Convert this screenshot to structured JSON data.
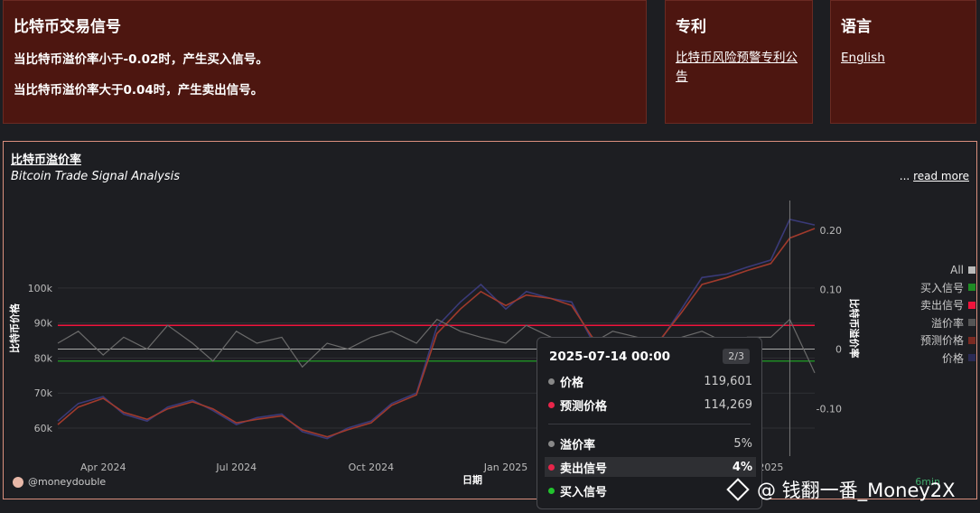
{
  "header": {
    "signals_title": "比特币交易信号",
    "buy_rule": "当比特币溢价率小于-0.02时，产生买入信号。",
    "sell_rule": "当比特币溢价率大于0.04时，产生卖出信号。",
    "patent_title": "专利",
    "patent_link": "比特币风险预警专利公告",
    "language_title": "语言",
    "language_link": "English"
  },
  "chart_panel": {
    "title": "比特币溢价率",
    "subtitle": "Bitcoin Trade Signal Analysis",
    "read_more_prefix": "...",
    "read_more": "read more",
    "author": "@moneydouble",
    "timeframe": "6min"
  },
  "tooltip": {
    "datetime": "2025-07-14 00:00",
    "page": "2/3",
    "rows": [
      {
        "label": "价格",
        "value": "119,601",
        "color": "#888888"
      },
      {
        "label": "预测价格",
        "value": "114,269",
        "color": "#e8254a"
      },
      {
        "label": "溢价率",
        "value": "5%",
        "color": "#888888"
      },
      {
        "label": "卖出信号",
        "value": "4%",
        "color": "#e8254a"
      },
      {
        "label": "买入信号",
        "value": "",
        "color": "#22c32e"
      }
    ]
  },
  "watermark": "@ 钱翻一番_Money2X",
  "chart_data": {
    "type": "line",
    "xlabel": "日期",
    "ylabel_left": "比特币价格",
    "ylabel_right": "比特币溢价率",
    "x_ticks": [
      "Apr 2024",
      "Jul 2024",
      "Oct 2024",
      "Jan 2025",
      "2025"
    ],
    "y_left_ticks": [
      "60k",
      "70k",
      "80k",
      "90k",
      "100k"
    ],
    "y_left_tick_values": [
      60000,
      70000,
      80000,
      90000,
      100000
    ],
    "y_right_ticks": [
      "-0.10",
      "0",
      "0.10",
      "0.20"
    ],
    "y_right_tick_values": [
      -0.1,
      0,
      0.1,
      0.2
    ],
    "ylim_left": [
      52000,
      125000
    ],
    "ylim_right": [
      -0.18,
      0.25
    ],
    "sell_threshold": 0.04,
    "buy_threshold": -0.02,
    "legend": [
      {
        "name": "All",
        "color": "#bbbbbb"
      },
      {
        "name": "买入信号",
        "color": "#1f8b24"
      },
      {
        "name": "卖出信号",
        "color": "#f0143c"
      },
      {
        "name": "溢价率",
        "color": "#555555"
      },
      {
        "name": "预测价格",
        "color": "#7a2a22"
      },
      {
        "name": "价格",
        "color": "#2b2b55"
      }
    ],
    "x_range": [
      "2024-03-01",
      "2025-07-31"
    ],
    "series": [
      {
        "name": "价格",
        "dates": [
          "2024-03-01",
          "2024-03-15",
          "2024-04-01",
          "2024-04-15",
          "2024-05-01",
          "2024-05-15",
          "2024-06-01",
          "2024-06-15",
          "2024-07-01",
          "2024-07-15",
          "2024-08-01",
          "2024-08-15",
          "2024-09-01",
          "2024-09-15",
          "2024-10-01",
          "2024-10-15",
          "2024-11-01",
          "2024-11-15",
          "2024-12-01",
          "2024-12-15",
          "2025-01-01",
          "2025-01-15",
          "2025-02-01",
          "2025-02-15",
          "2025-03-01",
          "2025-03-15",
          "2025-04-01",
          "2025-04-15",
          "2025-05-01",
          "2025-05-15",
          "2025-06-01",
          "2025-06-15",
          "2025-07-01",
          "2025-07-14",
          "2025-07-31"
        ],
        "values": [
          62000,
          67000,
          69000,
          64000,
          62000,
          66000,
          68000,
          65000,
          61000,
          63000,
          64000,
          59000,
          57000,
          60000,
          62000,
          67000,
          70000,
          89000,
          96000,
          101000,
          94000,
          99000,
          97000,
          96000,
          85000,
          83000,
          82000,
          84000,
          94000,
          103000,
          104000,
          106000,
          108000,
          119601,
          118000
        ]
      },
      {
        "name": "预测价格",
        "dates": [
          "2024-03-01",
          "2024-03-15",
          "2024-04-01",
          "2024-04-15",
          "2024-05-01",
          "2024-05-15",
          "2024-06-01",
          "2024-06-15",
          "2024-07-01",
          "2024-07-15",
          "2024-08-01",
          "2024-08-15",
          "2024-09-01",
          "2024-09-15",
          "2024-10-01",
          "2024-10-15",
          "2024-11-01",
          "2024-11-15",
          "2024-12-01",
          "2024-12-15",
          "2025-01-01",
          "2025-01-15",
          "2025-02-01",
          "2025-02-15",
          "2025-03-01",
          "2025-03-15",
          "2025-04-01",
          "2025-04-15",
          "2025-05-01",
          "2025-05-15",
          "2025-06-01",
          "2025-06-15",
          "2025-07-01",
          "2025-07-14",
          "2025-07-31"
        ],
        "values": [
          61000,
          66000,
          68500,
          64500,
          62500,
          65500,
          67500,
          65500,
          61500,
          62500,
          63500,
          59500,
          57500,
          59500,
          61500,
          66500,
          69500,
          87000,
          94000,
          99000,
          95000,
          98000,
          97000,
          95000,
          86000,
          84000,
          83000,
          84500,
          93000,
          101000,
          103000,
          105000,
          107000,
          114269,
          117000
        ]
      },
      {
        "name": "溢价率",
        "dates": [
          "2024-03-01",
          "2024-03-15",
          "2024-04-01",
          "2024-04-15",
          "2024-05-01",
          "2024-05-15",
          "2024-06-01",
          "2024-06-15",
          "2024-07-01",
          "2024-07-15",
          "2024-08-01",
          "2024-08-15",
          "2024-09-01",
          "2024-09-15",
          "2024-10-01",
          "2024-10-15",
          "2024-11-01",
          "2024-11-15",
          "2024-12-01",
          "2024-12-15",
          "2025-01-01",
          "2025-01-15",
          "2025-02-01",
          "2025-02-15",
          "2025-03-01",
          "2025-03-15",
          "2025-04-01",
          "2025-04-15",
          "2025-05-01",
          "2025-05-15",
          "2025-06-01",
          "2025-06-15",
          "2025-07-01",
          "2025-07-14",
          "2025-07-31"
        ],
        "values": [
          0.01,
          0.03,
          -0.01,
          0.02,
          0.0,
          0.04,
          0.01,
          -0.02,
          0.03,
          0.01,
          0.02,
          -0.03,
          0.01,
          0.0,
          0.02,
          0.03,
          0.01,
          0.05,
          0.03,
          0.02,
          0.01,
          0.04,
          0.02,
          0.0,
          0.01,
          0.03,
          0.02,
          0.01,
          0.02,
          0.03,
          0.01,
          0.02,
          0.02,
          0.05,
          -0.04
        ]
      }
    ]
  }
}
